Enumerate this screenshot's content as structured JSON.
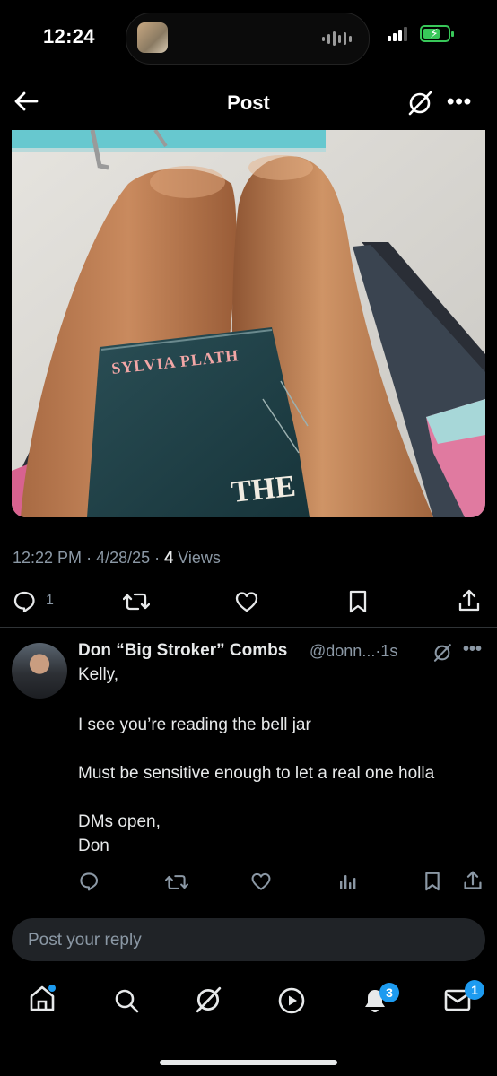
{
  "status_bar": {
    "time": "12:24"
  },
  "header": {
    "title": "Post"
  },
  "post": {
    "image_book_author": "SYLVIA PLATH",
    "image_book_title": "THE",
    "time": "12:22 PM",
    "date": "4/28/25",
    "views_count": "4",
    "views_label": "Views",
    "reply_count": "1"
  },
  "reply": {
    "name": "Don “Big Stroker” Combs",
    "handle": "@donn...",
    "age": "1s",
    "lines": [
      "Kelly,",
      "I see you’re reading the bell jar",
      "Must be sensitive enough to let a real one holla",
      "DMs open,",
      "Don"
    ]
  },
  "composer": {
    "placeholder": "Post your reply"
  },
  "nav": {
    "notifications_badge": "3",
    "messages_badge": "1"
  },
  "colors": {
    "accent": "#1d9bf0",
    "background": "#000000",
    "muted": "#8b98a5"
  }
}
